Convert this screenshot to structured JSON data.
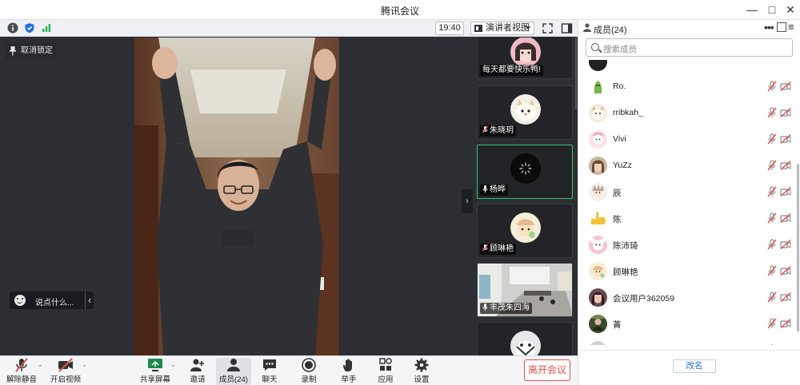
{
  "window": {
    "title": "腾讯会议"
  },
  "infobar": {
    "time": "19:40",
    "view_label": "演讲者视图"
  },
  "stage": {
    "unlock_label": "取消锁定",
    "chat_placeholder": "说点什么..."
  },
  "thumbnails": [
    {
      "name": "每天都要快乐鸭!",
      "muted": false,
      "speaking": false,
      "active": false
    },
    {
      "name": "朱晓玥",
      "muted": true,
      "speaking": false,
      "active": false
    },
    {
      "name": "杨晔",
      "muted": false,
      "speaking": true,
      "active": true
    },
    {
      "name": "顾琳艳",
      "muted": true,
      "speaking": false,
      "active": false
    },
    {
      "name": "丰茂朱四海",
      "muted": false,
      "speaking": true,
      "active": false
    },
    {
      "name": "",
      "muted": false,
      "speaking": false,
      "active": false
    }
  ],
  "toolbar": {
    "unmute": "解除静音",
    "start_video": "开启视频",
    "share_screen": "共享屏幕",
    "invite": "邀请",
    "members": "成员(24)",
    "chat": "聊天",
    "record": "录制",
    "raise_hand": "举手",
    "apps": "应用",
    "settings": "设置",
    "leave": "离开会议"
  },
  "panel": {
    "title": "成员(24)",
    "search_placeholder": "搜索成员",
    "rename": "改名",
    "members": [
      {
        "name": ""
      },
      {
        "name": "Ro."
      },
      {
        "name": "rribkah_"
      },
      {
        "name": "Vivi"
      },
      {
        "name": "YuZz"
      },
      {
        "name": "辰"
      },
      {
        "name": "陈"
      },
      {
        "name": "陈沛琦"
      },
      {
        "name": "顾琳艳"
      },
      {
        "name": "会议用户362059"
      },
      {
        "name": "菁"
      },
      {
        "name": ""
      }
    ]
  },
  "colors": {
    "accent_green": "#3cc36b",
    "leave_red": "#e0504a",
    "muted_red": "#e0504a",
    "link_blue": "#1a6ed8"
  }
}
